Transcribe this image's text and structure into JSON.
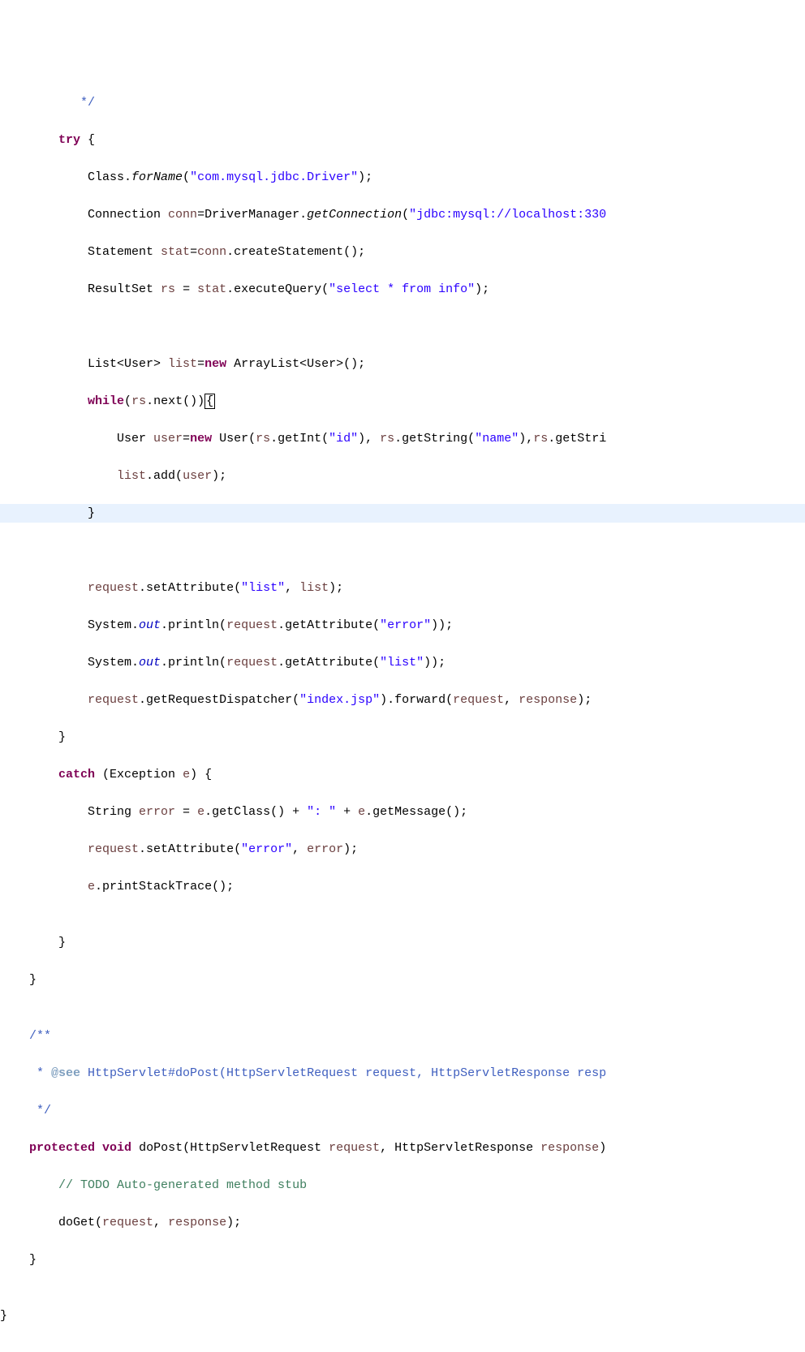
{
  "code": {
    "l0a": "           */",
    "l1_ind": "        ",
    "l1_try": "try",
    "l1_rest": " {",
    "l2_ind": "            Class.",
    "l2_forName": "forName",
    "l2_mid": "(",
    "l2_str": "\"com.mysql.jdbc.Driver\"",
    "l2_end": ");",
    "l3_ind": "            Connection ",
    "l3_conn": "conn",
    "l3_eq": "=DriverManager.",
    "l3_gc": "getConnection",
    "l3_open": "(",
    "l3_str": "\"jdbc:mysql://localhost:330",
    "l4_ind": "            Statement ",
    "l4_stat": "stat",
    "l4_eq": "=",
    "l4_conn": "conn",
    "l4_rest": ".createStatement();",
    "l5_ind": "            ResultSet ",
    "l5_rs": "rs",
    "l5_eq": " = ",
    "l5_stat": "stat",
    "l5_exec": ".executeQuery(",
    "l5_str": "\"select * from info\"",
    "l5_end": ");",
    "l6": "            ",
    "l7_ind": "            List<User> ",
    "l7_list": "list",
    "l7_eq": "=",
    "l7_new": "new",
    "l7_rest": " ArrayList<User>();",
    "l8_ind": "            ",
    "l8_while": "while",
    "l8_open": "(",
    "l8_rs": "rs",
    "l8_next": ".next())",
    "l8_brace": "{",
    "l9_ind": "                User ",
    "l9_user": "user",
    "l9_eq": "=",
    "l9_new": "new",
    "l9_open": " User(",
    "l9_rs1": "rs",
    "l9_getint": ".getInt(",
    "l9_id": "\"id\"",
    "l9_c1": "), ",
    "l9_rs2": "rs",
    "l9_gets": ".getString(",
    "l9_name": "\"name\"",
    "l9_c2": "),",
    "l9_rs3": "rs",
    "l9_getstri": ".getStri",
    "l10_ind": "                ",
    "l10_list": "list",
    "l10_add": ".add(",
    "l10_user": "user",
    "l10_end": ");",
    "l11": "            }",
    "l12": "            ",
    "l13_ind": "            ",
    "l13_req": "request",
    "l13_sa": ".setAttribute(",
    "l13_s1": "\"list\"",
    "l13_c": ", ",
    "l13_list": "list",
    "l13_end": ");",
    "l14_ind": "            System.",
    "l14_out": "out",
    "l14_pln": ".println(",
    "l14_req": "request",
    "l14_ga": ".getAttribute(",
    "l14_str": "\"error\"",
    "l14_end": "));",
    "l15_ind": "            System.",
    "l15_out": "out",
    "l15_pln": ".println(",
    "l15_req": "request",
    "l15_ga": ".getAttribute(",
    "l15_str": "\"list\"",
    "l15_end": "));",
    "l16_ind": "            ",
    "l16_req": "request",
    "l16_grd": ".getRequestDispatcher(",
    "l16_str": "\"index.jsp\"",
    "l16_fwd": ").forward(",
    "l16_req2": "request",
    "l16_c": ", ",
    "l16_resp": "response",
    "l16_end": ");",
    "l17": "        }",
    "l18_ind": "        ",
    "l18_catch": "catch",
    "l18_open": " (Exception ",
    "l18_e": "e",
    "l18_end": ") {",
    "l19_ind": "            String ",
    "l19_err": "error",
    "l19_eq": " = ",
    "l19_e": "e",
    "l19_gc": ".getClass() + ",
    "l19_str": "\": \"",
    "l19_plus": " + ",
    "l19_e2": "e",
    "l19_gm": ".getMessage();",
    "l20_ind": "            ",
    "l20_req": "request",
    "l20_sa": ".setAttribute(",
    "l20_str": "\"error\"",
    "l20_c": ", ",
    "l20_err": "error",
    "l20_end": ");",
    "l21_ind": "            ",
    "l21_e": "e",
    "l21_pst": ".printStackTrace();",
    "l22": "",
    "l23": "        }",
    "l24": "    }",
    "l25": "",
    "l26": "    /**",
    "l27_pre": "     * ",
    "l27_tag": "@see",
    "l27_rest": " HttpServlet#doPost(HttpServletRequest request, HttpServletResponse resp",
    "l28": "     */",
    "l29_ind": "    ",
    "l29_prot": "protected",
    "l29_sp": " ",
    "l29_void": "void",
    "l29_open": " doPost(HttpServletRequest ",
    "l29_req": "request",
    "l29_c": ", HttpServletResponse ",
    "l29_resp": "response",
    "l29_end": ")",
    "l30_ind": "        ",
    "l30_todo": "// TODO Auto-generated method stub",
    "l31_ind": "        doGet(",
    "l31_req": "request",
    "l31_c": ", ",
    "l31_resp": "response",
    "l31_end": ");",
    "l32": "    }",
    "l33": "",
    "l34": "}"
  }
}
